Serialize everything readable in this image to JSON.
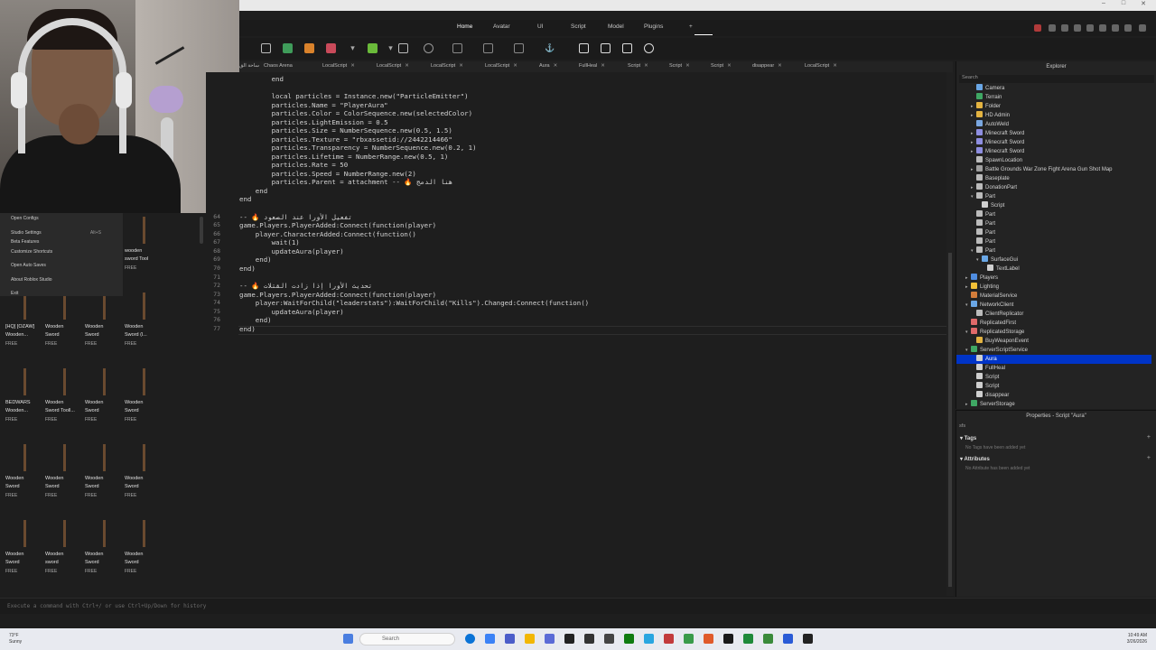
{
  "ribbon": {
    "tabs": [
      "Home",
      "Avatar",
      "UI",
      "Script",
      "Model",
      "Plugins"
    ],
    "add_label": "+"
  },
  "doc_tabs": [
    "ساحة الق",
    "Chaos Arena",
    "LocalScript",
    "LocalScript",
    "LocalScript",
    "LocalScript",
    "Aura",
    "FullHeal",
    "Script",
    "Script",
    "Script",
    "disappear",
    "LocalScript"
  ],
  "editor": {
    "lines": [
      {
        "n": "",
        "text": "        end"
      },
      {
        "n": "",
        "text": "        local particles = Instance.new(\"ParticleEmitter\")"
      },
      {
        "n": "",
        "text": "        particles.Name = \"PlayerAura\""
      },
      {
        "n": "",
        "text": "        particles.Color = ColorSequence.new(selectedColor)"
      },
      {
        "n": "",
        "text": "        particles.LightEmission = 0.5"
      },
      {
        "n": "",
        "text": "        particles.Size = NumberSequence.new(0.5, 1.5)"
      },
      {
        "n": "",
        "text": "        particles.Texture = \"rbxassetid://2442214466\""
      },
      {
        "n": "",
        "text": "        particles.Transparency = NumberSequence.new(0.2, 1)"
      },
      {
        "n": "",
        "text": "        particles.Lifetime = NumberRange.new(0.5, 1)"
      },
      {
        "n": "",
        "text": "        particles.Rate = 50"
      },
      {
        "n": "",
        "text": "        particles.Speed = NumberRange.new(2)"
      },
      {
        "n": "",
        "text": "        particles.Parent = attachment -- 🔥 هنا الدمج"
      },
      {
        "n": "",
        "text": "    end"
      },
      {
        "n": "",
        "text": "end"
      },
      {
        "n": "",
        "text": ""
      },
      {
        "n": "64",
        "text": "-- 🔥 تفعيل الأورا عند الصعود"
      },
      {
        "n": "65",
        "text": "game.Players.PlayerAdded:Connect(function(player)"
      },
      {
        "n": "66",
        "text": "    player.CharacterAdded:Connect(function()"
      },
      {
        "n": "67",
        "text": "        wait(1)"
      },
      {
        "n": "68",
        "text": "        updateAura(player)"
      },
      {
        "n": "69",
        "text": "    end)"
      },
      {
        "n": "70",
        "text": "end)"
      },
      {
        "n": "71",
        "text": ""
      },
      {
        "n": "72",
        "text": "-- 🔥 تحديث الأورا إذا زادت القتلات"
      },
      {
        "n": "73",
        "text": "game.Players.PlayerAdded:Connect(function(player)"
      },
      {
        "n": "74",
        "text": "    player:WaitForChild(\"leaderstats\"):WaitForChild(\"Kills\").Changed:Connect(function()"
      },
      {
        "n": "75",
        "text": "        updateAura(player)"
      },
      {
        "n": "76",
        "text": "    end)"
      },
      {
        "n": "77",
        "text": "end)"
      }
    ]
  },
  "command_bar": {
    "placeholder": "Execute a command with Ctrl+/ or use Ctrl+Up/Down for history"
  },
  "explorer": {
    "title": "Explorer",
    "search_placeholder": "Search",
    "items": [
      {
        "label": "Camera",
        "depth": 1,
        "icon": "#6aa7e6",
        "arrow": ""
      },
      {
        "label": "Terrain",
        "depth": 1,
        "icon": "#3fa864",
        "arrow": ""
      },
      {
        "label": "Folder",
        "depth": 1,
        "icon": "#e3b341",
        "arrow": "▸"
      },
      {
        "label": "HD Admin",
        "depth": 1,
        "icon": "#e3b341",
        "arrow": "▸"
      },
      {
        "label": "AutoWeld",
        "depth": 1,
        "icon": "#7aa7e0",
        "arrow": ""
      },
      {
        "label": "Minecraft Sword",
        "depth": 1,
        "icon": "#8e8ee0",
        "arrow": "▸"
      },
      {
        "label": "Minecraft Sword",
        "depth": 1,
        "icon": "#8e8ee0",
        "arrow": "▸"
      },
      {
        "label": "Minecraft Sword",
        "depth": 1,
        "icon": "#8e8ee0",
        "arrow": "▸"
      },
      {
        "label": "SpawnLocation",
        "depth": 1,
        "icon": "#bbbbbb",
        "arrow": ""
      },
      {
        "label": "Battle Grounds War Zone Fight Arena Gun Shot Map",
        "depth": 1,
        "icon": "#a0a0a0",
        "arrow": "▸"
      },
      {
        "label": "Baseplate",
        "depth": 1,
        "icon": "#bbbbbb",
        "arrow": ""
      },
      {
        "label": "DonationPart",
        "depth": 1,
        "icon": "#bbbbbb",
        "arrow": "▸"
      },
      {
        "label": "Part",
        "depth": 1,
        "icon": "#bbbbbb",
        "arrow": "▾"
      },
      {
        "label": "Script",
        "depth": 2,
        "icon": "#cfcfcf",
        "arrow": ""
      },
      {
        "label": "Part",
        "depth": 1,
        "icon": "#bbbbbb",
        "arrow": ""
      },
      {
        "label": "Part",
        "depth": 1,
        "icon": "#bbbbbb",
        "arrow": ""
      },
      {
        "label": "Part",
        "depth": 1,
        "icon": "#bbbbbb",
        "arrow": ""
      },
      {
        "label": "Part",
        "depth": 1,
        "icon": "#bbbbbb",
        "arrow": ""
      },
      {
        "label": "Part",
        "depth": 1,
        "icon": "#bbbbbb",
        "arrow": "▾"
      },
      {
        "label": "SurfaceGui",
        "depth": 2,
        "icon": "#6aa7e6",
        "arrow": "▾"
      },
      {
        "label": "TextLabel",
        "depth": 3,
        "icon": "#cfcfcf",
        "arrow": ""
      },
      {
        "label": "Players",
        "depth": 0,
        "icon": "#4f8de0",
        "arrow": "▸"
      },
      {
        "label": "Lighting",
        "depth": 0,
        "icon": "#f2c037",
        "arrow": "▸"
      },
      {
        "label": "MaterialService",
        "depth": 0,
        "icon": "#d47d3a",
        "arrow": ""
      },
      {
        "label": "NetworkClient",
        "depth": 0,
        "icon": "#6aa7e6",
        "arrow": "▾"
      },
      {
        "label": "ClientReplicator",
        "depth": 1,
        "icon": "#bbbbbb",
        "arrow": ""
      },
      {
        "label": "ReplicatedFirst",
        "depth": 0,
        "icon": "#e06a6a",
        "arrow": ""
      },
      {
        "label": "ReplicatedStorage",
        "depth": 0,
        "icon": "#e06a6a",
        "arrow": "▾"
      },
      {
        "label": "BuyWeaponEvent",
        "depth": 1,
        "icon": "#e3b341",
        "arrow": ""
      },
      {
        "label": "ServerScriptService",
        "depth": 0,
        "icon": "#3fa864",
        "arrow": "▾"
      },
      {
        "label": "Aura",
        "depth": 1,
        "icon": "#cfcfcf",
        "arrow": "",
        "selected": true
      },
      {
        "label": "FullHeal",
        "depth": 1,
        "icon": "#cfcfcf",
        "arrow": ""
      },
      {
        "label": "Script",
        "depth": 1,
        "icon": "#cfcfcf",
        "arrow": ""
      },
      {
        "label": "Script",
        "depth": 1,
        "icon": "#cfcfcf",
        "arrow": ""
      },
      {
        "label": "disappear",
        "depth": 1,
        "icon": "#cfcfcf",
        "arrow": ""
      },
      {
        "label": "ServerStorage",
        "depth": 0,
        "icon": "#3fa864",
        "arrow": "▸"
      }
    ]
  },
  "properties": {
    "title": "Properties - Script \"Aura\"",
    "filter_text": "sfs",
    "tags_header": "Tags",
    "tags_note": "No Tags have been added yet",
    "attributes_header": "Attributes",
    "attributes_note": "No Attribute has been added yet"
  },
  "context_menu": {
    "items": [
      {
        "label": "Open Configs",
        "shortcut": ""
      },
      {
        "label": "Studio Settings",
        "shortcut": "Alt+S"
      },
      {
        "label": "Beta Features",
        "shortcut": ""
      },
      {
        "label": "Customize Shortcuts",
        "shortcut": ""
      },
      {
        "label": "Open Auto Saves",
        "shortcut": ""
      },
      {
        "label": "About Roblox Studio",
        "shortcut": ""
      },
      {
        "label": "Exit",
        "shortcut": ""
      }
    ]
  },
  "toolbox": {
    "items": [
      {
        "title": "wooden\nsword Tool",
        "price": "FREE"
      },
      {
        "title": "[HQ] [OZAW]\nWooden...",
        "price": "FREE"
      },
      {
        "title": "Wooden\nSword",
        "price": "FREE"
      },
      {
        "title": "Wooden\nSword",
        "price": "FREE"
      },
      {
        "title": "Wooden\nSword (l...",
        "price": "FREE"
      },
      {
        "title": "BEDWARS\nWooden...",
        "price": "FREE"
      },
      {
        "title": "Wooden\nSword Tooll...",
        "price": "FREE"
      },
      {
        "title": "Wooden\nSword",
        "price": "FREE"
      },
      {
        "title": "Wooden\nSword",
        "price": "FREE"
      },
      {
        "title": "Wooden\nSword",
        "price": "FREE"
      },
      {
        "title": "Wooden\nSword",
        "price": "FREE"
      },
      {
        "title": "Wooden\nSword",
        "price": "FREE"
      },
      {
        "title": "Wooden\nSword",
        "price": "FREE"
      },
      {
        "title": "Wooden\nSword",
        "price": "FREE"
      },
      {
        "title": "Wooden\nsword",
        "price": "FREE"
      },
      {
        "title": "Wooden\nSword",
        "price": "FREE"
      },
      {
        "title": "Wooden\nSword",
        "price": "FREE"
      }
    ]
  },
  "taskbar": {
    "weather": "73°F\nSunny",
    "search_placeholder": "Search",
    "time": "10:49 AM",
    "date": "3/26/2026"
  }
}
